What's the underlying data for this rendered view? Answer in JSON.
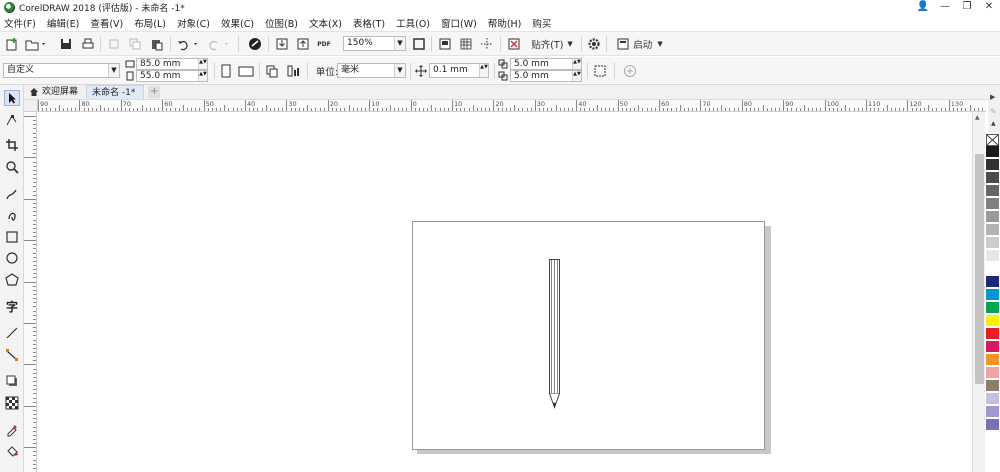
{
  "window": {
    "title": "CorelDRAW 2018 (评估版) - 未命名 -1*",
    "controls": [
      "minimize-icon",
      "restore-icon",
      "close-icon"
    ]
  },
  "menu": [
    "文件(F)",
    "编辑(E)",
    "查看(V)",
    "布局(L)",
    "对象(C)",
    "效果(C)",
    "位图(B)",
    "文本(X)",
    "表格(T)",
    "工具(O)",
    "窗口(W)",
    "帮助(H)",
    "购买"
  ],
  "standard_toolbar": {
    "zoom": "150%",
    "snap_label": "贴齐(T)",
    "launch_label": "启动"
  },
  "property_bar": {
    "page_preset": "自定义",
    "width": "85.0 mm",
    "height": "55.0 mm",
    "units_label": "单位:",
    "units": "毫米",
    "nudge": "0.1 mm",
    "dup_x": "5.0 mm",
    "dup_y": "5.0 mm"
  },
  "tabs": [
    {
      "label": "欢迎屏幕",
      "icon": "home-icon",
      "active": false
    },
    {
      "label": "未命名 -1*",
      "icon": "",
      "active": true
    }
  ],
  "ruler": {
    "h_labels": [
      "90",
      "80",
      "70",
      "60",
      "50",
      "40",
      "30",
      "20",
      "10",
      "0",
      "10",
      "20",
      "30",
      "40",
      "50",
      "60",
      "70",
      "80",
      "90",
      "100",
      "110",
      "120",
      "130"
    ]
  },
  "palette": [
    "#ffffff",
    "#1a1a1a",
    "#333333",
    "#4d4d4d",
    "#666666",
    "#808080",
    "#999999",
    "#b3b3b3",
    "#cccccc",
    "#e6e6e6",
    "#ffffff",
    "#1d2a7a",
    "#0096d6",
    "#00a651",
    "#fff200",
    "#ed1c24",
    "#d81b60",
    "#f7931e",
    "#f4a3a3",
    "#8b7d6b",
    "#c5bfe0",
    "#9f97d1",
    "#7a6fb8"
  ],
  "accent": "#dfe9f7"
}
